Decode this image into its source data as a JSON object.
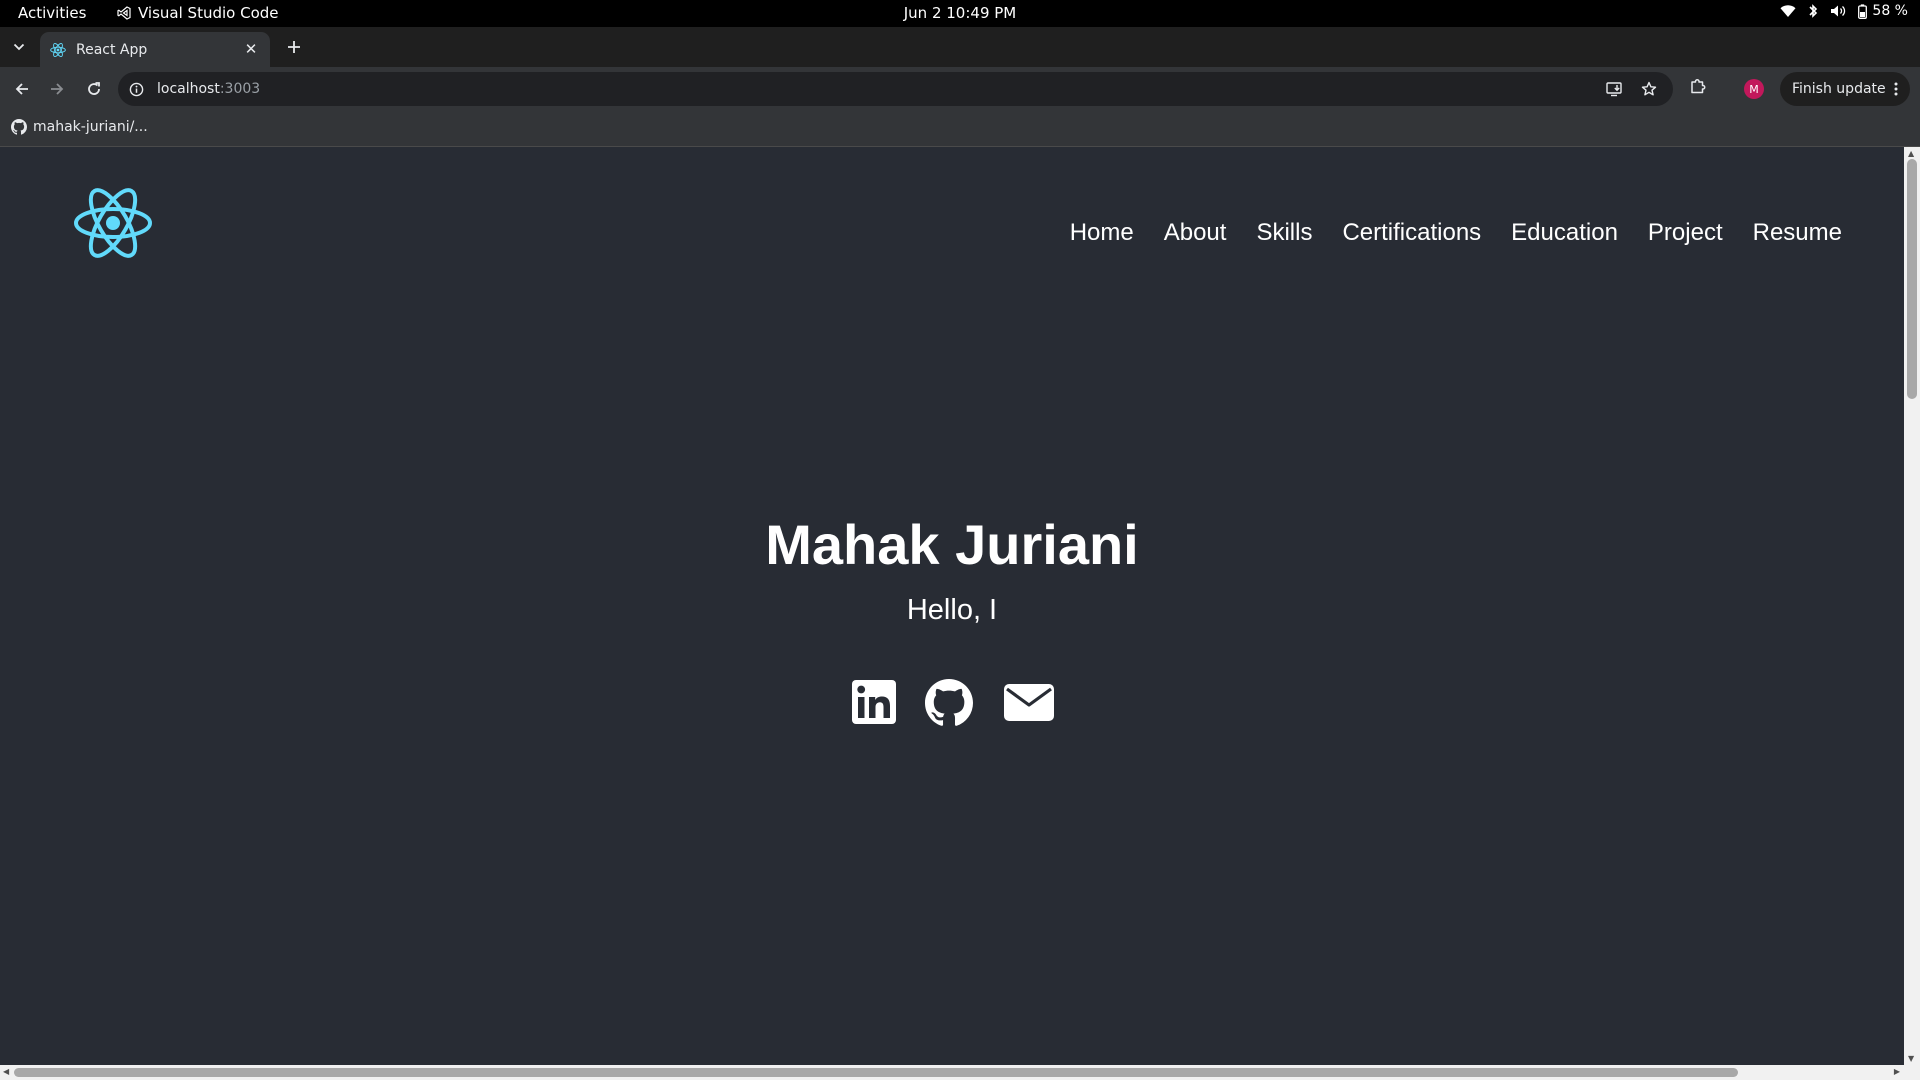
{
  "system_bar": {
    "activities": "Activities",
    "app_name": "Visual Studio Code",
    "datetime": "Jun 2  10:49 PM",
    "battery": "58 %",
    "icons": [
      "wifi-icon",
      "bluetooth-icon",
      "volume-icon",
      "battery-icon"
    ]
  },
  "browser": {
    "tab": {
      "title": "React App",
      "favicon": "react-icon"
    },
    "address": {
      "host": "localhost",
      "port": ":3003"
    },
    "update_button": "Finish update",
    "avatar_initial": "M",
    "bookmarks": [
      {
        "label": "mahak-juriani/...",
        "icon": "github-icon"
      }
    ]
  },
  "page": {
    "nav": [
      "Home",
      "About",
      "Skills",
      "Certifications",
      "Education",
      "Project",
      "Resume"
    ],
    "hero": {
      "name": "Mahak Juriani",
      "greeting": "Hello, I"
    },
    "socials": [
      "linkedin-icon",
      "github-icon",
      "mail-icon"
    ],
    "colors": {
      "background": "#282c34",
      "react_logo": "#61dafb",
      "text": "#ffffff"
    }
  }
}
